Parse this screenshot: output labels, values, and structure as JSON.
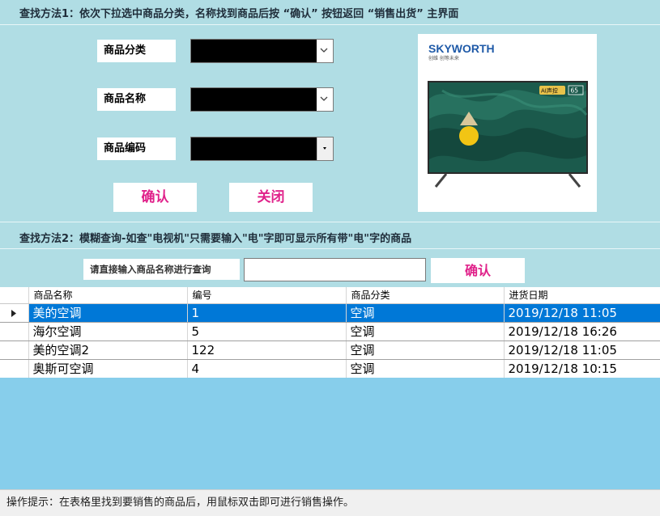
{
  "search1": {
    "hint": "查找方法1：依次下拉选中商品分类，名称找到商品后按 “确认” 按钮返回 “销售出货” 主界面",
    "category_label": "商品分类",
    "name_label": "商品名称",
    "code_label": "商品编码",
    "confirm_label": "确认",
    "close_label": "关闭"
  },
  "product_image": {
    "brand": "SKYWORTH",
    "slogan": "创维  创等未来",
    "badge_text": "AI声控",
    "badge_size": "65"
  },
  "search2": {
    "hint": "查找方法2：模糊查询-如查\"电视机\"只需要输入\"电\"字即可显示所有带\"电\"字的商品",
    "label": "请直接输入商品名称进行查询",
    "input_value": "",
    "confirm_label": "确认"
  },
  "grid": {
    "columns": [
      "商品名称",
      "编号",
      "商品分类",
      "进货日期"
    ],
    "rows": [
      [
        "美的空调",
        "1",
        "空调",
        "2019/12/18 11:05"
      ],
      [
        "海尔空调",
        "5",
        "空调",
        "2019/12/18 16:26"
      ],
      [
        "美的空调2",
        "122",
        "空调",
        "2019/12/18 11:05"
      ],
      [
        "奥斯可空调",
        "4",
        "空调",
        "2019/12/18 10:15"
      ]
    ],
    "selected_row": 0
  },
  "status": {
    "text": "操作提示：在表格里找到要销售的商品后，用鼠标双击即可进行销售操作。"
  },
  "colors": {
    "background": "#b0dde4",
    "button_text": "#e0218a",
    "selection": "#0078d7",
    "empty_area": "#87ceeb"
  }
}
